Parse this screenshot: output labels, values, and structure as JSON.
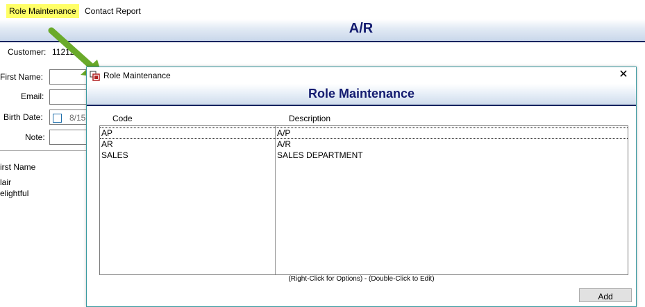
{
  "menu": {
    "items": [
      {
        "label": "Role Maintenance",
        "active": true
      },
      {
        "label": "Contact Report",
        "active": false
      }
    ],
    "highlight_color": "#ffff66"
  },
  "background_window": {
    "title": "A/R",
    "customer_label": "Customer:",
    "customer_value": "11212",
    "first_name_label": "First Name:",
    "email_label": "Email:",
    "birth_date_label": "Birth Date:",
    "birth_date_value": "8/15",
    "note_label": "Note:",
    "list_header": "irst Name",
    "list_rows": [
      "lair",
      "elightful"
    ]
  },
  "annotation": {
    "arrow_color": "#6aaa2a",
    "arrow_icon": "green-arrow-icon"
  },
  "dialog": {
    "window_title": "Role Maintenance",
    "heading": "Role Maintenance",
    "close_glyph": "✕",
    "columns": {
      "code": "Code",
      "description": "Description"
    },
    "rows": [
      {
        "code": "AP",
        "description": "A/P",
        "selected": true
      },
      {
        "code": "AR",
        "description": "A/R",
        "selected": false
      },
      {
        "code": "SALES",
        "description": "SALES DEPARTMENT",
        "selected": false
      }
    ],
    "hint": "(Right-Click for Options) - (Double-Click to Edit)",
    "add_button": "Add",
    "heading_color": "#141c70"
  }
}
